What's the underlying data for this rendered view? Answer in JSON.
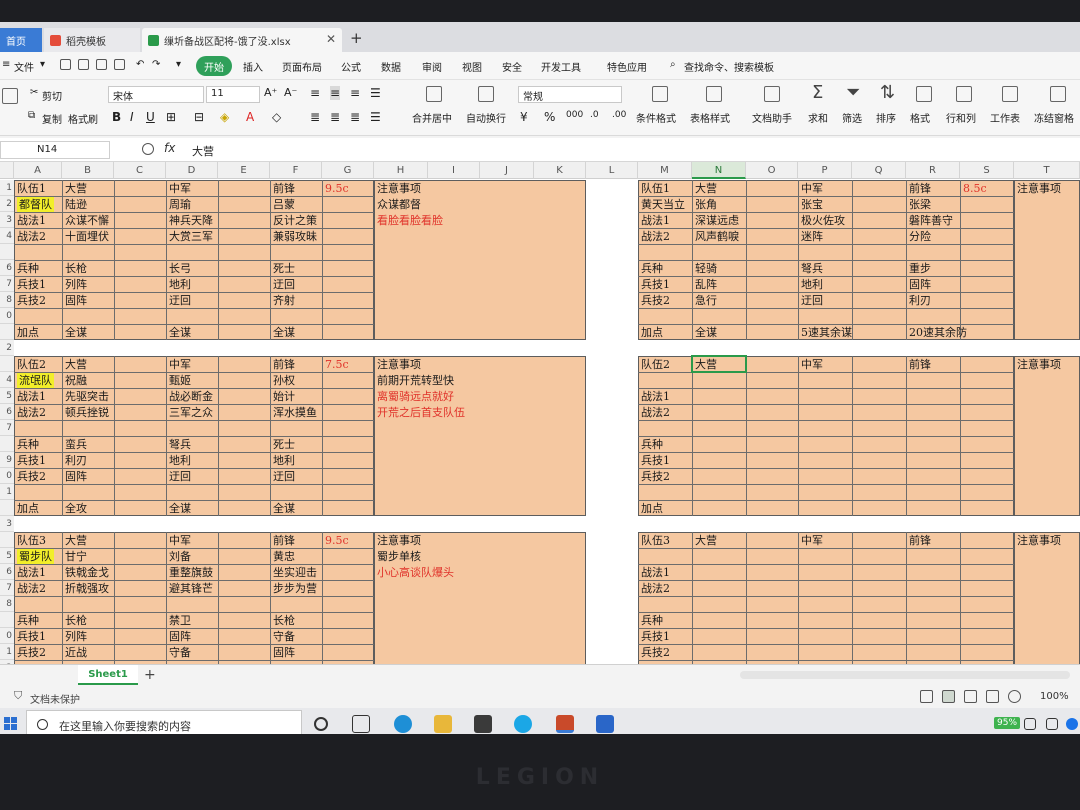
{
  "tabs": {
    "home": "首页",
    "template": "稻壳模板",
    "file": "缫圻备战区配将-饿了没.xlsx",
    "add": "+"
  },
  "menu": {
    "file": "文件",
    "start": "开始",
    "items": [
      "插入",
      "页面布局",
      "公式",
      "数据",
      "审阅",
      "视图",
      "安全",
      "开发工具",
      "特色应用"
    ],
    "search": "查找命令、搜索模板"
  },
  "ribbon": {
    "cut": "剪切",
    "copy": "复制",
    "format_painter": "格式刷",
    "font_name": "宋体",
    "font_size": "11",
    "merge": "合并居中",
    "wrap": "自动换行",
    "number_format": "常规",
    "cond_format": "条件格式",
    "table_style": "表格样式",
    "doc_helper": "文档助手",
    "sum": "求和",
    "filter": "筛选",
    "sort": "排序",
    "format": "格式",
    "rowcol": "行和列",
    "worksheet": "工作表",
    "freeze": "冻结窗格"
  },
  "formula_bar": {
    "name_box": "N14",
    "fx": "fx",
    "content": "大营"
  },
  "grid": {
    "columns": [
      "A",
      "B",
      "C",
      "D",
      "E",
      "F",
      "G",
      "H",
      "I",
      "J",
      "K",
      "L",
      "M",
      "N",
      "O",
      "P",
      "Q",
      "R",
      "S",
      "T"
    ],
    "selected_column": "N",
    "row_numbers": [
      "1",
      "2",
      "3",
      "4",
      "",
      "6",
      "7",
      "8",
      "0",
      "",
      "2",
      "",
      "4",
      "5",
      "6",
      "7",
      "",
      "9",
      "0",
      "1",
      "",
      "3",
      "",
      "5",
      "6",
      "7",
      "8",
      "",
      "0",
      "1",
      "2"
    ],
    "cells": [
      {
        "t": "队伍1",
        "c": "",
        "k": "a1"
      },
      {
        "t": "大营",
        "c": "",
        "k": "b1"
      },
      {
        "t": "中军",
        "c": "",
        "k": "d1"
      },
      {
        "t": "前锋",
        "c": "",
        "k": "f1"
      },
      {
        "t": "9.5c",
        "c": "red",
        "k": "g1"
      },
      {
        "t": "注意事项",
        "c": "",
        "k": "h1"
      },
      {
        "t": "都督队",
        "c": "yb",
        "k": "a2"
      },
      {
        "t": "陆逊",
        "c": "",
        "k": "b2"
      },
      {
        "t": "周瑜",
        "c": "",
        "k": "d2"
      },
      {
        "t": "吕蒙",
        "c": "",
        "k": "f2"
      },
      {
        "t": "众谋都督",
        "c": "",
        "k": "h2"
      },
      {
        "t": "战法1",
        "c": "",
        "k": "a3"
      },
      {
        "t": "众谋不懈",
        "c": "",
        "k": "b3"
      },
      {
        "t": "神兵天降",
        "c": "",
        "k": "d3"
      },
      {
        "t": "反计之策",
        "c": "",
        "k": "f3"
      },
      {
        "t": "看脸看脸看脸",
        "c": "red",
        "k": "h3"
      },
      {
        "t": "战法2",
        "c": "",
        "k": "a4"
      },
      {
        "t": "十面埋伏",
        "c": "",
        "k": "b4"
      },
      {
        "t": "大赏三军",
        "c": "",
        "k": "d4"
      },
      {
        "t": "兼弱攻昧",
        "c": "",
        "k": "f4"
      },
      {
        "t": "兵种",
        "c": "",
        "k": "a6"
      },
      {
        "t": "长枪",
        "c": "",
        "k": "b6"
      },
      {
        "t": "长弓",
        "c": "",
        "k": "d6"
      },
      {
        "t": "死士",
        "c": "",
        "k": "f6"
      },
      {
        "t": "兵技1",
        "c": "",
        "k": "a7"
      },
      {
        "t": "列阵",
        "c": "",
        "k": "b7"
      },
      {
        "t": "地利",
        "c": "",
        "k": "d7"
      },
      {
        "t": "迂回",
        "c": "",
        "k": "f7"
      },
      {
        "t": "兵技2",
        "c": "",
        "k": "a8"
      },
      {
        "t": "固阵",
        "c": "",
        "k": "b8"
      },
      {
        "t": "迂回",
        "c": "",
        "k": "d8"
      },
      {
        "t": "齐射",
        "c": "",
        "k": "f8"
      },
      {
        "t": "加点",
        "c": "",
        "k": "a10"
      },
      {
        "t": "全谋",
        "c": "",
        "k": "b10"
      },
      {
        "t": "全谋",
        "c": "",
        "k": "d10"
      },
      {
        "t": "全谋",
        "c": "",
        "k": "f10"
      },
      {
        "t": "队伍2",
        "c": "",
        "k": "a12"
      },
      {
        "t": "大营",
        "c": "",
        "k": "b12"
      },
      {
        "t": "中军",
        "c": "",
        "k": "d12"
      },
      {
        "t": "前锋",
        "c": "",
        "k": "f12"
      },
      {
        "t": "7.5c",
        "c": "red",
        "k": "g12"
      },
      {
        "t": "注意事项",
        "c": "",
        "k": "h12"
      },
      {
        "t": "流氓队",
        "c": "yb",
        "k": "a13"
      },
      {
        "t": "祝融",
        "c": "",
        "k": "b13"
      },
      {
        "t": "甄姬",
        "c": "",
        "k": "d13"
      },
      {
        "t": "孙权",
        "c": "",
        "k": "f13"
      },
      {
        "t": "前期开荒转型快",
        "c": "",
        "k": "h13"
      },
      {
        "t": "战法1",
        "c": "",
        "k": "a14"
      },
      {
        "t": "先驱突击",
        "c": "",
        "k": "b14"
      },
      {
        "t": "战必断金",
        "c": "",
        "k": "d14"
      },
      {
        "t": "始计",
        "c": "",
        "k": "f14"
      },
      {
        "t": "离蜀骑远点就好",
        "c": "red",
        "k": "h14"
      },
      {
        "t": "战法2",
        "c": "",
        "k": "a15"
      },
      {
        "t": "顿兵挫锐",
        "c": "",
        "k": "b15"
      },
      {
        "t": "三军之众",
        "c": "",
        "k": "d15"
      },
      {
        "t": "浑水摸鱼",
        "c": "",
        "k": "f15"
      },
      {
        "t": "开荒之后首支队伍",
        "c": "red",
        "k": "h15"
      },
      {
        "t": "兵种",
        "c": "",
        "k": "a17"
      },
      {
        "t": "蛮兵",
        "c": "",
        "k": "b17"
      },
      {
        "t": "弩兵",
        "c": "",
        "k": "d17"
      },
      {
        "t": "死士",
        "c": "",
        "k": "f17"
      },
      {
        "t": "兵技1",
        "c": "",
        "k": "a18"
      },
      {
        "t": "利刃",
        "c": "",
        "k": "b18"
      },
      {
        "t": "地利",
        "c": "",
        "k": "d18"
      },
      {
        "t": "地利",
        "c": "",
        "k": "f18"
      },
      {
        "t": "兵技2",
        "c": "",
        "k": "a19"
      },
      {
        "t": "固阵",
        "c": "",
        "k": "b19"
      },
      {
        "t": "迂回",
        "c": "",
        "k": "d19"
      },
      {
        "t": "迂回",
        "c": "",
        "k": "f19"
      },
      {
        "t": "加点",
        "c": "",
        "k": "a21"
      },
      {
        "t": "全攻",
        "c": "",
        "k": "b21"
      },
      {
        "t": "全谋",
        "c": "",
        "k": "d21"
      },
      {
        "t": "全谋",
        "c": "",
        "k": "f21"
      },
      {
        "t": "队伍3",
        "c": "",
        "k": "a23"
      },
      {
        "t": "大营",
        "c": "",
        "k": "b23"
      },
      {
        "t": "中军",
        "c": "",
        "k": "d23"
      },
      {
        "t": "前锋",
        "c": "",
        "k": "f23"
      },
      {
        "t": "9.5c",
        "c": "red",
        "k": "g23"
      },
      {
        "t": "注意事项",
        "c": "",
        "k": "h23"
      },
      {
        "t": "蜀步队",
        "c": "yb",
        "k": "a24"
      },
      {
        "t": "甘宁",
        "c": "",
        "k": "b24"
      },
      {
        "t": "刘备",
        "c": "",
        "k": "d24"
      },
      {
        "t": "黄忠",
        "c": "",
        "k": "f24"
      },
      {
        "t": "蜀步单核",
        "c": "",
        "k": "h24"
      },
      {
        "t": "战法1",
        "c": "",
        "k": "a25"
      },
      {
        "t": "铁戟金戈",
        "c": "",
        "k": "b25"
      },
      {
        "t": "重整旗鼓",
        "c": "",
        "k": "d25"
      },
      {
        "t": "坐实迎击",
        "c": "",
        "k": "f25"
      },
      {
        "t": "小心高谈队爆头",
        "c": "red",
        "k": "h25"
      },
      {
        "t": "战法2",
        "c": "",
        "k": "a26"
      },
      {
        "t": "折戟强攻",
        "c": "",
        "k": "b26"
      },
      {
        "t": "避其锋芒",
        "c": "",
        "k": "d26"
      },
      {
        "t": "步步为营",
        "c": "",
        "k": "f26"
      },
      {
        "t": "兵种",
        "c": "",
        "k": "a28"
      },
      {
        "t": "长枪",
        "c": "",
        "k": "b28"
      },
      {
        "t": "禁卫",
        "c": "",
        "k": "d28"
      },
      {
        "t": "长枪",
        "c": "",
        "k": "f28"
      },
      {
        "t": "兵技1",
        "c": "",
        "k": "a29"
      },
      {
        "t": "列阵",
        "c": "",
        "k": "b29"
      },
      {
        "t": "固阵",
        "c": "",
        "k": "d29"
      },
      {
        "t": "守备",
        "c": "",
        "k": "f29"
      },
      {
        "t": "兵技2",
        "c": "",
        "k": "a30"
      },
      {
        "t": "近战",
        "c": "",
        "k": "b30"
      },
      {
        "t": "守备",
        "c": "",
        "k": "d30"
      },
      {
        "t": "固阵",
        "c": "",
        "k": "f30"
      },
      {
        "t": "队伍1",
        "c": "",
        "k": "m1"
      },
      {
        "t": "大营",
        "c": "",
        "k": "n1"
      },
      {
        "t": "中军",
        "c": "",
        "k": "p1"
      },
      {
        "t": "前锋",
        "c": "",
        "k": "r1"
      },
      {
        "t": "8.5c",
        "c": "red",
        "k": "s1"
      },
      {
        "t": "注意事项",
        "c": "",
        "k": "t1"
      },
      {
        "t": "黄天当立",
        "c": "",
        "k": "m2"
      },
      {
        "t": "张角",
        "c": "",
        "k": "n2"
      },
      {
        "t": "张宝",
        "c": "",
        "k": "p2"
      },
      {
        "t": "张梁",
        "c": "",
        "k": "r2"
      },
      {
        "t": "战法1",
        "c": "",
        "k": "m3"
      },
      {
        "t": "深谋远虑",
        "c": "",
        "k": "n3"
      },
      {
        "t": "极火佐攻",
        "c": "",
        "k": "p3"
      },
      {
        "t": "磐阵善守",
        "c": "",
        "k": "r3"
      },
      {
        "t": "战法2",
        "c": "",
        "k": "m4"
      },
      {
        "t": "风声鹤唳",
        "c": "",
        "k": "n4"
      },
      {
        "t": "迷阵",
        "c": "",
        "k": "p4"
      },
      {
        "t": "分险",
        "c": "",
        "k": "r4"
      },
      {
        "t": "兵种",
        "c": "",
        "k": "m6"
      },
      {
        "t": "轻骑",
        "c": "",
        "k": "n6"
      },
      {
        "t": "弩兵",
        "c": "",
        "k": "p6"
      },
      {
        "t": "重步",
        "c": "",
        "k": "r6"
      },
      {
        "t": "兵技1",
        "c": "",
        "k": "m7"
      },
      {
        "t": "乱阵",
        "c": "",
        "k": "n7"
      },
      {
        "t": "地利",
        "c": "",
        "k": "p7"
      },
      {
        "t": "固阵",
        "c": "",
        "k": "r7"
      },
      {
        "t": "兵技2",
        "c": "",
        "k": "m8"
      },
      {
        "t": "急行",
        "c": "",
        "k": "n8"
      },
      {
        "t": "迂回",
        "c": "",
        "k": "p8"
      },
      {
        "t": "利刃",
        "c": "",
        "k": "r8"
      },
      {
        "t": "加点",
        "c": "",
        "k": "m10"
      },
      {
        "t": "全谋",
        "c": "",
        "k": "n10"
      },
      {
        "t": "5速其余谋",
        "c": "",
        "k": "p10"
      },
      {
        "t": "20速其余防",
        "c": "",
        "k": "r10"
      },
      {
        "t": "队伍2",
        "c": "",
        "k": "m12"
      },
      {
        "t": "大营",
        "c": "",
        "k": "n12"
      },
      {
        "t": "中军",
        "c": "",
        "k": "p12"
      },
      {
        "t": "前锋",
        "c": "",
        "k": "r12"
      },
      {
        "t": "注意事项",
        "c": "",
        "k": "t12"
      },
      {
        "t": "战法1",
        "c": "",
        "k": "m14"
      },
      {
        "t": "战法2",
        "c": "",
        "k": "m15"
      },
      {
        "t": "兵种",
        "c": "",
        "k": "m17"
      },
      {
        "t": "兵技1",
        "c": "",
        "k": "m18"
      },
      {
        "t": "兵技2",
        "c": "",
        "k": "m19"
      },
      {
        "t": "加点",
        "c": "",
        "k": "m21"
      },
      {
        "t": "队伍3",
        "c": "",
        "k": "m23"
      },
      {
        "t": "大营",
        "c": "",
        "k": "n23"
      },
      {
        "t": "中军",
        "c": "",
        "k": "p23"
      },
      {
        "t": "前锋",
        "c": "",
        "k": "r23"
      },
      {
        "t": "注意事项",
        "c": "",
        "k": "t23"
      },
      {
        "t": "战法1",
        "c": "",
        "k": "m25"
      },
      {
        "t": "战法2",
        "c": "",
        "k": "m26"
      },
      {
        "t": "兵种",
        "c": "",
        "k": "m28"
      },
      {
        "t": "兵技1",
        "c": "",
        "k": "m29"
      },
      {
        "t": "兵技2",
        "c": "",
        "k": "m30"
      }
    ]
  },
  "sheets": {
    "active": "Sheet1",
    "add": "+"
  },
  "status": {
    "protection": "文档未保护",
    "zoom": "100%"
  },
  "taskbar": {
    "search_placeholder": "在这里输入你要搜索的内容",
    "battery": "95%"
  },
  "bezel_brand": "LEGION",
  "colors": {
    "cell_fill": "#f5c8a1",
    "team_tag": "#f2ee2a",
    "note_red": "#e0322a",
    "accent_green": "#2a9a4a"
  }
}
